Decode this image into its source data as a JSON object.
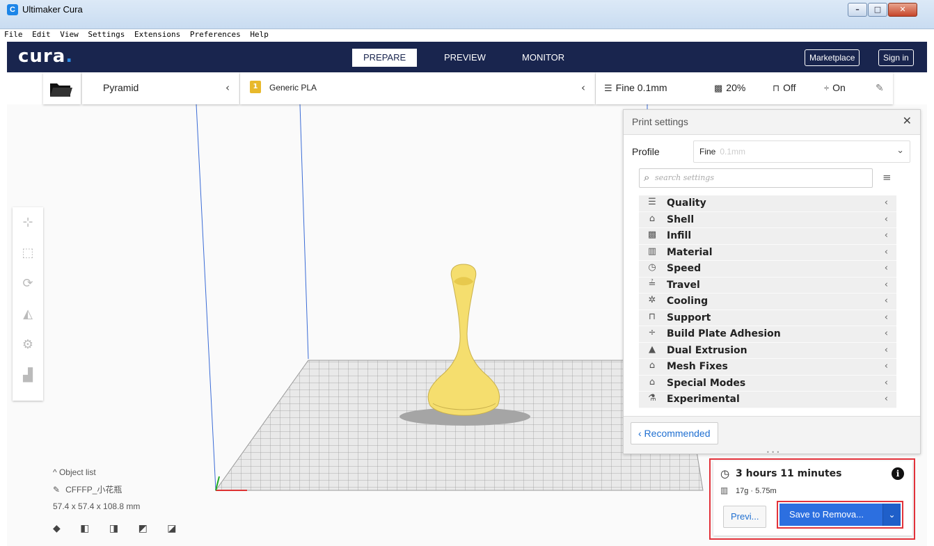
{
  "window": {
    "title": "Ultimaker Cura",
    "app_icon": "C",
    "controls": {
      "minimize": "–",
      "maximize": "□",
      "close": "✕"
    }
  },
  "menu": [
    "File",
    "Edit",
    "View",
    "Settings",
    "Extensions",
    "Preferences",
    "Help"
  ],
  "header": {
    "logo": "cura",
    "logo_dot": ".",
    "tabs": [
      {
        "label": "PREPARE",
        "active": true
      },
      {
        "label": "PREVIEW",
        "active": false
      },
      {
        "label": "MONITOR",
        "active": false
      }
    ],
    "marketplace": "Marketplace",
    "signin": "Sign in"
  },
  "toolbar": {
    "open_icon": "folder-icon",
    "printer": "Pyramid",
    "material_badge": "1",
    "material": "Generic PLA",
    "chevron": "‹",
    "quality": "Fine 0.1mm",
    "infill": "20%",
    "support": "Off",
    "adhesion": "On",
    "quality_icon": "☰",
    "infill_icon": "▩",
    "support_icon": "⊓",
    "adhesion_icon": "÷",
    "edit_icon": "✎"
  },
  "print_settings": {
    "title": "Print settings",
    "close": "✕",
    "profile_label": "Profile",
    "profile_value": "Fine",
    "profile_sub": "0.1mm",
    "search_placeholder": "search settings",
    "categories": [
      {
        "label": "Quality",
        "icon": "☰"
      },
      {
        "label": "Shell",
        "icon": "⌂"
      },
      {
        "label": "Infill",
        "icon": "▩"
      },
      {
        "label": "Material",
        "icon": "▥"
      },
      {
        "label": "Speed",
        "icon": "◷"
      },
      {
        "label": "Travel",
        "icon": "≟"
      },
      {
        "label": "Cooling",
        "icon": "✲"
      },
      {
        "label": "Support",
        "icon": "⊓"
      },
      {
        "label": "Build Plate Adhesion",
        "icon": "÷"
      },
      {
        "label": "Dual Extrusion",
        "icon": "▲"
      },
      {
        "label": "Mesh Fixes",
        "icon": "⌂"
      },
      {
        "label": "Special Modes",
        "icon": "⌂"
      },
      {
        "label": "Experimental",
        "icon": "⚗"
      }
    ],
    "recommended_button": "‹ Recommended"
  },
  "object_list": {
    "header": "^  Object list",
    "object_name": "CFFFP_小花瓶",
    "dimensions": "57.4 x 57.4 x 108.8 mm",
    "view_icons": "◆ ◧ ◨ ◩ ◪"
  },
  "output": {
    "time": "3 hours 11 minutes",
    "material": "17g · 5.75m",
    "preview_button": "Previ...",
    "save_button": "Save to Remova...",
    "dropdown": "⌄",
    "info": "i"
  },
  "colors": {
    "header_bg": "#19254e",
    "accent": "#2c6fe0",
    "model": "#f7e17a",
    "highlight": "#e2323a"
  }
}
